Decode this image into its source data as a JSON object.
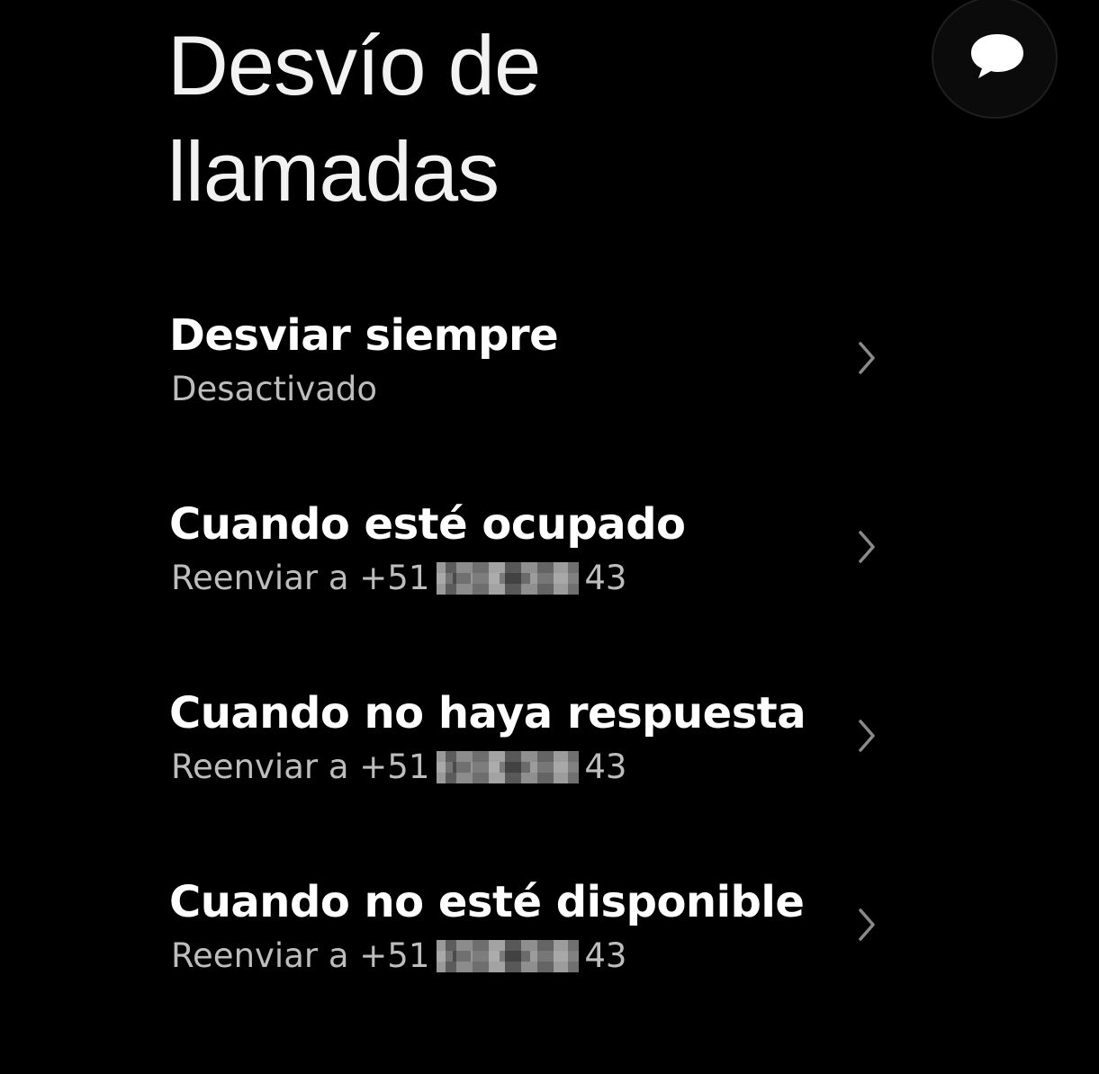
{
  "header": {
    "title_line1": "Desvío de",
    "title_line2": "llamadas"
  },
  "chat_button": {
    "icon": "chat-bubble-icon"
  },
  "rows": [
    {
      "title": "Desviar siempre",
      "subtitle": "Desactivado",
      "prefix": "",
      "suffix": "",
      "icon": "chevron-right-icon"
    },
    {
      "title": "Cuando esté ocupado",
      "subtitle": "",
      "prefix": "Reenviar a +51",
      "suffix": "43",
      "icon": "chevron-right-icon"
    },
    {
      "title": "Cuando no haya respuesta",
      "subtitle": "",
      "prefix": "Reenviar a +51",
      "suffix": "43",
      "icon": "chevron-right-icon"
    },
    {
      "title": "Cuando no esté disponible",
      "subtitle": "",
      "prefix": "Reenviar a +51",
      "suffix": "43",
      "icon": "chevron-right-icon"
    }
  ],
  "colors": {
    "background": "#000000",
    "title_text": "#ffffff",
    "subtitle_text": "#bdbdbd",
    "chevron": "#8a8a8a"
  }
}
